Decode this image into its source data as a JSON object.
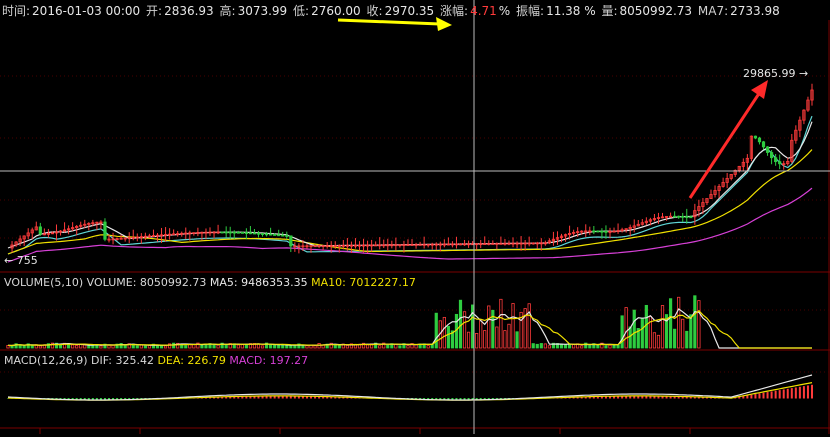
{
  "header": {
    "time_label": "时间:",
    "time_value": "2016-01-03  00:00",
    "open_label": "开:",
    "open_value": "2836.93",
    "high_label": "高:",
    "high_value": "3073.99",
    "low_label": "低:",
    "low_value": "2760.00",
    "close_label": "收:",
    "close_value": "2970.35",
    "change_label": "涨幅:",
    "change_value": "4.71",
    "change_unit": "%",
    "amplitude_label": "振幅:",
    "amplitude_value": "11.38 %",
    "volume_label": "量:",
    "volume_value": "8050992.73",
    "ma7_label": "MA7:",
    "ma7_value": "2733.98"
  },
  "price_panel": {
    "max_price_label": "29865.99 →",
    "min_price_label": "← 755"
  },
  "volume_panel": {
    "title": "VOLUME(5,10)",
    "volume_label": "VOLUME:",
    "volume_value": "8050992.73",
    "ma5_label": "MA5:",
    "ma5_value": "9486353.35",
    "ma10_label": "MA10:",
    "ma10_value": "7012227.17"
  },
  "macd_panel": {
    "title": "MACD(12,26,9)",
    "dif_label": "DIF:",
    "dif_value": "325.42",
    "dea_label": "DEA:",
    "dea_value": "226.79",
    "macd_label": "MACD:",
    "macd_value": "197.27"
  },
  "colors": {
    "background": "#000000",
    "up": "#ff3b3b",
    "down": "#2ecc40",
    "ma_white": "#e8e8e8",
    "ma_yellow": "#f0e000",
    "ma_magenta": "#d640d6",
    "ma_cyan": "#5fd6d6",
    "annotation_arrow_yellow": "#ffff00",
    "annotation_arrow_red": "#ff2a2a"
  }
}
